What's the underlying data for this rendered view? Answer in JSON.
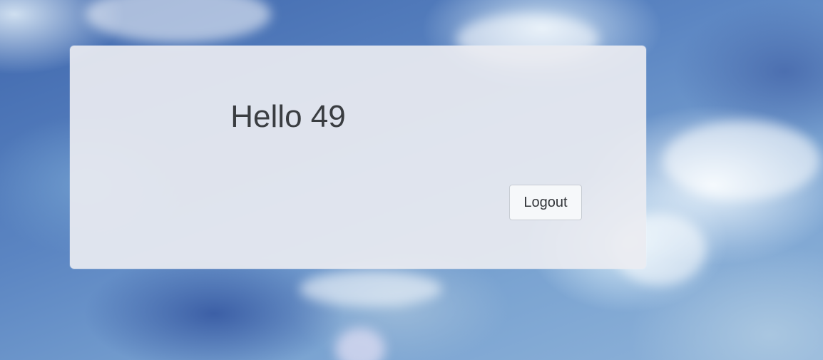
{
  "panel": {
    "greeting": "Hello 49",
    "logout_label": "Logout"
  }
}
